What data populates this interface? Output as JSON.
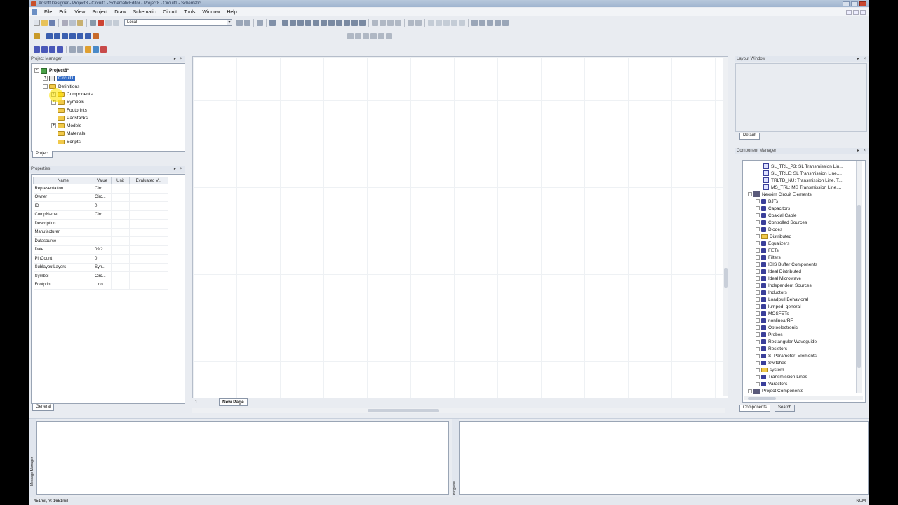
{
  "window": {
    "title": "Ansoft Designer - Project8 - Circuit1 - SchematicEditor - Project8 - Circuit1 - Schematic"
  },
  "menu": [
    "File",
    "Edit",
    "View",
    "Project",
    "Draw",
    "Schematic",
    "Circuit",
    "Tools",
    "Window",
    "Help"
  ],
  "toolbar": {
    "layer_select_value": "Local"
  },
  "project_manager": {
    "title": "Project Manager",
    "tab": "Project",
    "tree": [
      {
        "label": "Project8*",
        "indent": 0,
        "exp": "-",
        "icon": "project"
      },
      {
        "label": "Circuit1",
        "indent": 1,
        "exp": "+",
        "icon": "circuit",
        "selected": true
      },
      {
        "label": "Definitions",
        "indent": 1,
        "exp": "-",
        "icon": "folder"
      },
      {
        "label": "Components",
        "indent": 2,
        "exp": "+",
        "icon": "folder"
      },
      {
        "label": "Symbols",
        "indent": 2,
        "exp": "+",
        "icon": "folder"
      },
      {
        "label": "Footprints",
        "indent": 2,
        "exp": "",
        "icon": "folder"
      },
      {
        "label": "Padstacks",
        "indent": 2,
        "exp": "",
        "icon": "folder"
      },
      {
        "label": "Models",
        "indent": 2,
        "exp": "+",
        "icon": "folder"
      },
      {
        "label": "Materials",
        "indent": 2,
        "exp": "",
        "icon": "folder"
      },
      {
        "label": "Scripts",
        "indent": 2,
        "exp": "",
        "icon": "folder"
      }
    ]
  },
  "properties": {
    "title": "Properties",
    "tab": "General",
    "columns": [
      "Name",
      "Value",
      "Unit",
      "Evaluated V..."
    ],
    "rows": [
      [
        "Representation",
        "Circ...",
        "",
        ""
      ],
      [
        "Owner",
        "Circ...",
        "",
        ""
      ],
      [
        "ID",
        "0",
        "",
        ""
      ],
      [
        "CompName",
        "Circ...",
        "",
        ""
      ],
      [
        "Description",
        "",
        "",
        ""
      ],
      [
        "Manufacturer",
        "",
        "",
        ""
      ],
      [
        "Datasource",
        "",
        "",
        ""
      ],
      [
        "Date",
        "09/2...",
        "",
        ""
      ],
      [
        "PinCount",
        "0",
        "",
        ""
      ],
      [
        "SublayoutLayers",
        "Syn...",
        "",
        ""
      ],
      [
        "Symbol",
        "Circ...",
        "",
        ""
      ],
      [
        "Footprint",
        "...no...",
        "",
        ""
      ]
    ]
  },
  "canvas": {
    "page_tab": "New Page",
    "page_index": "1"
  },
  "layout_window": {
    "title": "Layout Window",
    "tab": "Default"
  },
  "component_manager": {
    "title": "Component Manager",
    "tabs": [
      "Components",
      "Search"
    ],
    "items": [
      {
        "label": "SL_TRL_P3: SL Transmission Lin...",
        "indent": 2,
        "icon": "comp"
      },
      {
        "label": "SL_TRLE: SL Transmission Line,...",
        "indent": 2,
        "icon": "comp"
      },
      {
        "label": "TRLTD_NU: Transmission Line, T...",
        "indent": 2,
        "icon": "comp"
      },
      {
        "label": "MS_TRL: MS Transmission Line,...",
        "indent": 2,
        "icon": "comp"
      },
      {
        "label": "Nexxim Circuit Elements",
        "indent": 0,
        "icon": "root"
      },
      {
        "label": "BJTs",
        "indent": 1,
        "icon": "lib"
      },
      {
        "label": "Capacitors",
        "indent": 1,
        "icon": "lib"
      },
      {
        "label": "Coaxial Cable",
        "indent": 1,
        "icon": "lib"
      },
      {
        "label": "Controlled Sources",
        "indent": 1,
        "icon": "lib"
      },
      {
        "label": "Diodes",
        "indent": 1,
        "icon": "lib"
      },
      {
        "label": "Distributed",
        "indent": 1,
        "icon": "folder"
      },
      {
        "label": "Equalizers",
        "indent": 1,
        "icon": "lib"
      },
      {
        "label": "FETs",
        "indent": 1,
        "icon": "lib"
      },
      {
        "label": "Filters",
        "indent": 1,
        "icon": "lib"
      },
      {
        "label": "IBIS Buffer Components",
        "indent": 1,
        "icon": "lib"
      },
      {
        "label": "Ideal Distributed",
        "indent": 1,
        "icon": "lib"
      },
      {
        "label": "Ideal Microwave",
        "indent": 1,
        "icon": "lib"
      },
      {
        "label": "Independent Sources",
        "indent": 1,
        "icon": "lib"
      },
      {
        "label": "Inductors",
        "indent": 1,
        "icon": "lib"
      },
      {
        "label": "Loadpull Behavioral",
        "indent": 1,
        "icon": "lib"
      },
      {
        "label": "lumped_general",
        "indent": 1,
        "icon": "lib"
      },
      {
        "label": "MOSFETs",
        "indent": 1,
        "icon": "lib"
      },
      {
        "label": "nonlinearRF",
        "indent": 1,
        "icon": "lib"
      },
      {
        "label": "Optoelectronic",
        "indent": 1,
        "icon": "lib"
      },
      {
        "label": "Probes",
        "indent": 1,
        "icon": "lib"
      },
      {
        "label": "Rectangular Waveguide",
        "indent": 1,
        "icon": "lib"
      },
      {
        "label": "Resistors",
        "indent": 1,
        "icon": "lib"
      },
      {
        "label": "S_Parameter_Elements",
        "indent": 1,
        "icon": "lib"
      },
      {
        "label": "Switches",
        "indent": 1,
        "icon": "lib"
      },
      {
        "label": "system",
        "indent": 1,
        "icon": "folder"
      },
      {
        "label": "Transmission Lines",
        "indent": 1,
        "icon": "lib"
      },
      {
        "label": "Varactors",
        "indent": 1,
        "icon": "lib"
      },
      {
        "label": "Project Components",
        "indent": 0,
        "icon": "root"
      }
    ]
  },
  "message_manager": {
    "title": "Message Manager"
  },
  "progress": {
    "title": "Progress"
  },
  "status": {
    "coords": "-451mil, Y: 1651mil",
    "right": "NUM"
  }
}
